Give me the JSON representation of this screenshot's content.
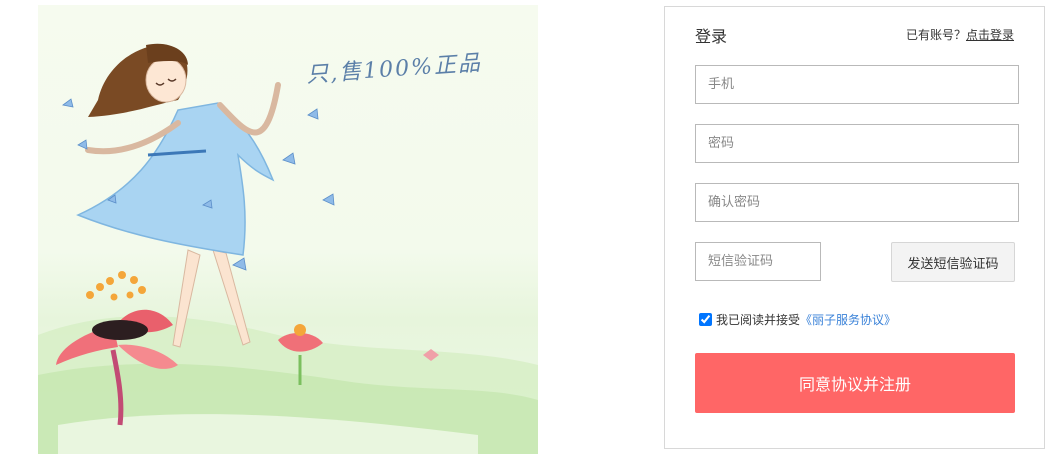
{
  "illustration": {
    "slogan": "只,售100%正品"
  },
  "form": {
    "title": "登录",
    "have_account_text": "已有账号？",
    "login_link": "点击登录",
    "phone_placeholder": "手机",
    "password_placeholder": "密码",
    "confirm_placeholder": "确认密码",
    "sms_placeholder": "短信验证码",
    "send_sms_label": "发送短信验证码",
    "agree_checked": true,
    "agree_text": "我已阅读并接受",
    "agreement_link": "《丽子服务协议》",
    "submit_label": "同意协议并注册"
  },
  "colors": {
    "accent": "#ff6666",
    "link": "#3a82d8"
  }
}
